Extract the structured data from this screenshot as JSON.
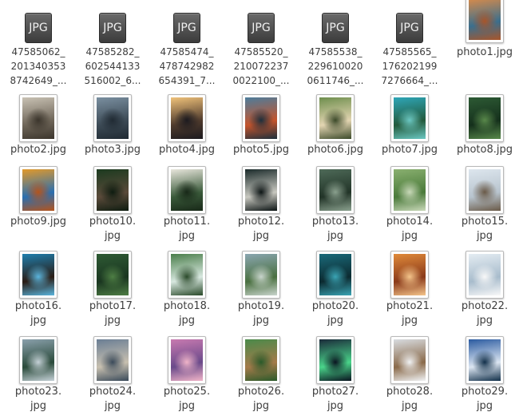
{
  "files": [
    {
      "label": "47585062_\n201340353\n8742649_...",
      "type": "JPG",
      "colors": []
    },
    {
      "label": "47585282_\n602544133\n516002_6...",
      "type": "JPG",
      "colors": []
    },
    {
      "label": "47585474_\n478742982\n654391_7...",
      "type": "JPG",
      "colors": []
    },
    {
      "label": "47585520_\n210072237\n0022100_...",
      "type": "JPG",
      "colors": []
    },
    {
      "label": "47585538_\n229610020\n0611746_...",
      "type": "JPG",
      "colors": []
    },
    {
      "label": "47585565_\n176202199\n7276664_...",
      "type": "JPG",
      "colors": []
    },
    {
      "label": "photo1.jpg",
      "type": "photo",
      "colors": [
        "#d98b4a",
        "#3a6f8e",
        "#a8552a"
      ]
    },
    {
      "label": "photo2.jpg",
      "type": "photo",
      "colors": [
        "#c9c2b4",
        "#6e6558",
        "#3b352c"
      ]
    },
    {
      "label": "photo3.jpg",
      "type": "photo",
      "colors": [
        "#7a8fa0",
        "#3c4a55",
        "#202a33"
      ]
    },
    {
      "label": "photo4.jpg",
      "type": "photo",
      "colors": [
        "#f0c27a",
        "#4e3a2c",
        "#1c1a1f"
      ]
    },
    {
      "label": "photo5.jpg",
      "type": "photo",
      "colors": [
        "#4d7d9c",
        "#c4542c",
        "#1d2f3c"
      ]
    },
    {
      "label": "photo6.jpg",
      "type": "photo",
      "colors": [
        "#6e8e4d",
        "#e3d5b2",
        "#3c4a2a"
      ]
    },
    {
      "label": "photo7.jpg",
      "type": "photo",
      "colors": [
        "#2ea6b8",
        "#235a3c",
        "#6bc7c2"
      ]
    },
    {
      "label": "photo8.jpg",
      "type": "photo",
      "colors": [
        "#2d5a34",
        "#15301c",
        "#58884a"
      ]
    },
    {
      "label": "photo9.jpg",
      "type": "photo",
      "colors": [
        "#e39a2a",
        "#2a6fb0",
        "#b5541c"
      ]
    },
    {
      "label": "photo10.\njpg",
      "type": "photo",
      "colors": [
        "#1b3a1f",
        "#5a4a3a",
        "#0e1c10"
      ]
    },
    {
      "label": "photo11.\njpg",
      "type": "photo",
      "colors": [
        "#e8e6dc",
        "#3a5a3a",
        "#182818"
      ]
    },
    {
      "label": "photo12.\njpg",
      "type": "photo",
      "colors": [
        "#1a2a2a",
        "#c8c8c0",
        "#0c1414"
      ]
    },
    {
      "label": "photo13.\njpg",
      "type": "photo",
      "colors": [
        "#4e6a58",
        "#223428",
        "#8aa08e"
      ]
    },
    {
      "label": "photo14.\njpg",
      "type": "photo",
      "colors": [
        "#8ab070",
        "#4a7a3a",
        "#c8d8b8"
      ]
    },
    {
      "label": "photo15.\njpg",
      "type": "photo",
      "colors": [
        "#dde6ee",
        "#b8c4ce",
        "#6a5a48"
      ]
    },
    {
      "label": "photo16.\njpg",
      "type": "photo",
      "colors": [
        "#1f7fae",
        "#2a1c14",
        "#5ab4dc"
      ]
    },
    {
      "label": "photo17.\njpg",
      "type": "photo",
      "colors": [
        "#2e5a34",
        "#1a3620",
        "#4e7e44"
      ]
    },
    {
      "label": "photo18.\njpg",
      "type": "photo",
      "colors": [
        "#4a7e4a",
        "#d8e8e0",
        "#2a4a2a"
      ]
    },
    {
      "label": "photo19.\njpg",
      "type": "photo",
      "colors": [
        "#8aa6b0",
        "#4a7040",
        "#c8d4cc"
      ]
    },
    {
      "label": "photo20.\njpg",
      "type": "photo",
      "colors": [
        "#1a6a7a",
        "#0c2a30",
        "#3aa4b4"
      ]
    },
    {
      "label": "photo21.\njpg",
      "type": "photo",
      "colors": [
        "#e08a3a",
        "#8a3a1a",
        "#f4c48a"
      ]
    },
    {
      "label": "photo22.\njpg",
      "type": "photo",
      "colors": [
        "#e4ecf2",
        "#a8bccc",
        "#f8f8f8"
      ]
    },
    {
      "label": "photo23.\njpg",
      "type": "photo",
      "colors": [
        "#8aa0ac",
        "#2a4a3a",
        "#c4d0d6"
      ]
    },
    {
      "label": "photo24.\njpg",
      "type": "photo",
      "colors": [
        "#6a7e94",
        "#c8c0b0",
        "#3a4a5a"
      ]
    },
    {
      "label": "photo25.\njpg",
      "type": "photo",
      "colors": [
        "#c87ab0",
        "#6a4a8a",
        "#f0b4c8"
      ]
    },
    {
      "label": "photo26.\njpg",
      "type": "photo",
      "colors": [
        "#4a8a4a",
        "#a47a4a",
        "#2a5a2a"
      ]
    },
    {
      "label": "photo27.\njpg",
      "type": "photo",
      "colors": [
        "#1a2a3a",
        "#4ad48a",
        "#0a1420"
      ]
    },
    {
      "label": "photo28.\njpg",
      "type": "photo",
      "colors": [
        "#d8dce0",
        "#8a6a4a",
        "#f0f2f4"
      ]
    },
    {
      "label": "photo29.\njpg",
      "type": "photo",
      "colors": [
        "#2a5aa0",
        "#dce6f2",
        "#12304a"
      ]
    }
  ]
}
